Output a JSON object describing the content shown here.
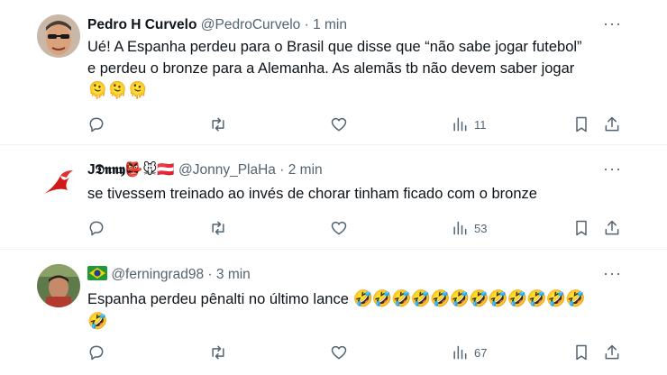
{
  "tweets": [
    {
      "name": "Pedro H Curvelo",
      "handle": "@PedroCurvelo",
      "dot": "·",
      "time": "1 min",
      "more": "···",
      "text_line1": "Ué! A Espanha perdeu para o Brasil que disse que “não sabe jogar futebol”",
      "text_line2": "e perdeu o bronze para a Alemanha. As alemãs tb não devem saber jogar",
      "emoji_line": "🫠🫠🫠",
      "views": "11"
    },
    {
      "name": "J𝕯𝖓𝖓𝖞👺🐭🇦🇹",
      "handle": "@Jonny_PlaHa",
      "dot": "·",
      "time": "2 min",
      "more": "···",
      "text_line1": "se tivessem treinado ao invés de chorar tinham ficado com o bronze",
      "views": "53"
    },
    {
      "handle": "@ferningrad98",
      "dot": "·",
      "time": "3 min",
      "more": "···",
      "text_line1": "Espanha perdeu pênalti no último lance",
      "emoji_tail": "🤣🤣🤣🤣🤣🤣🤣🤣🤣🤣🤣🤣",
      "emoji_line": "🤣",
      "views": "67"
    }
  ],
  "icons": [
    "reply-icon",
    "retweet-icon",
    "like-icon",
    "views-icon",
    "bookmark-icon",
    "share-icon"
  ],
  "colors": {
    "secondary_text": "#536471",
    "divider": "#eff3f4"
  }
}
